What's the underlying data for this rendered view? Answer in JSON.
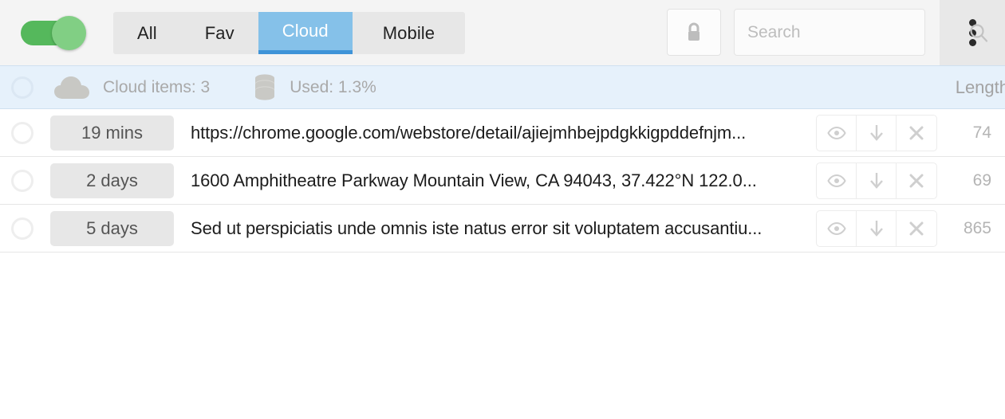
{
  "toolbar": {
    "toggle": {
      "name": "power-toggle",
      "state": "on",
      "on_color": "#55b85c",
      "knob_color": "#81cf84"
    },
    "tabs": [
      {
        "label": "All",
        "active": false
      },
      {
        "label": "Fav",
        "active": false
      },
      {
        "label": "Cloud",
        "active": true
      },
      {
        "label": "Mobile",
        "active": false
      }
    ],
    "active_tab": "Cloud",
    "active_tab_color": "#85c1e9",
    "active_tab_underline": "#3f94d8",
    "lock_button": {
      "icon": "lock-icon",
      "label": ""
    },
    "search": {
      "value": "",
      "placeholder": "Search",
      "icon": "search-icon"
    },
    "overflow_menu": {
      "icon": "more-vertical-icon",
      "label": ""
    }
  },
  "infobar": {
    "background": "#e6f1fb",
    "cloud_icon": "cloud-icon",
    "cloud_items_label": "Cloud items: 3",
    "db_icon": "database-icon",
    "used_label": "Used: 1.3%",
    "length_header": "Length"
  },
  "list": {
    "action_icons": [
      "eye-icon",
      "download-arrow-icon",
      "close-x-icon"
    ],
    "rows": [
      {
        "age": "19 mins",
        "text": "https://chrome.google.com/webstore/detail/ajiejmhbejpdgkkigpddefnjm...",
        "length": "74"
      },
      {
        "age": "2 days",
        "text": "1600 Amphitheatre Parkway Mountain View, CA 94043, 37.422°N 122.0...",
        "length": "69"
      },
      {
        "age": "5 days",
        "text": "Sed ut perspiciatis unde omnis iste natus error sit voluptatem accusantiu...",
        "length": "865"
      }
    ]
  }
}
